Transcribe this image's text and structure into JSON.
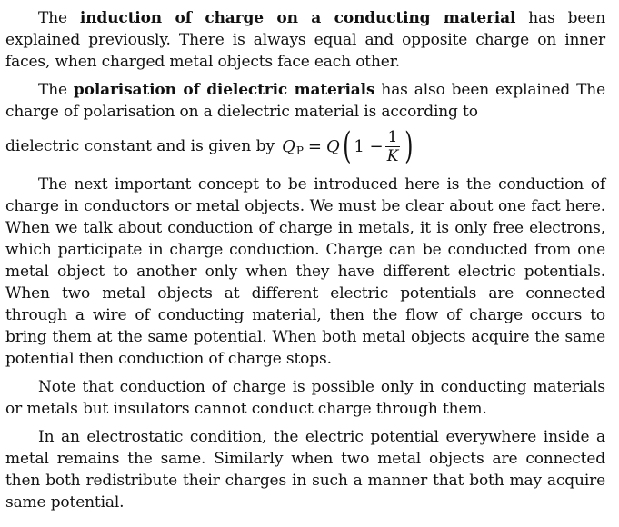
{
  "para1": {
    "lead": "The ",
    "bold": "induction of charge on a conducting material",
    "rest": " has been explained previously. There is always equal and opposite charge on inner faces, when charged metal objects face each other."
  },
  "para2": {
    "lead": "The ",
    "bold": "polarisation of dielectric materials",
    "rest": " has also been explained The charge of polarisation on a dielectric material is according to"
  },
  "equation_line": {
    "text": "dielectric constant and is given by",
    "q": "Q",
    "sub": "P",
    "equals": "=",
    "q2": "Q",
    "one_minus": "1 −",
    "numerator": "1",
    "denominator": "K"
  },
  "para3": "The next important concept to be introduced here is the conduction of charge in conductors or metal objects. We must be clear about one fact here. When we talk about conduction of charge in metals, it is only free electrons, which participate in charge conduction. Charge can be conducted from one metal object to another only when they have different electric potentials. When two metal objects at different electric potentials are connected through a wire of conducting material, then the flow of charge occurs to bring them at the same potential. When both metal objects acquire the same potential then conduction of charge stops.",
  "para4": "Note that conduction of charge is possible only in conducting materials or metals but insulators cannot conduct charge through them.",
  "para5": "In an electrostatic condition, the electric potential everywhere inside a metal remains the same. Similarly when two metal objects are connected then both redistribute their charges in such a manner that both may acquire same potential."
}
